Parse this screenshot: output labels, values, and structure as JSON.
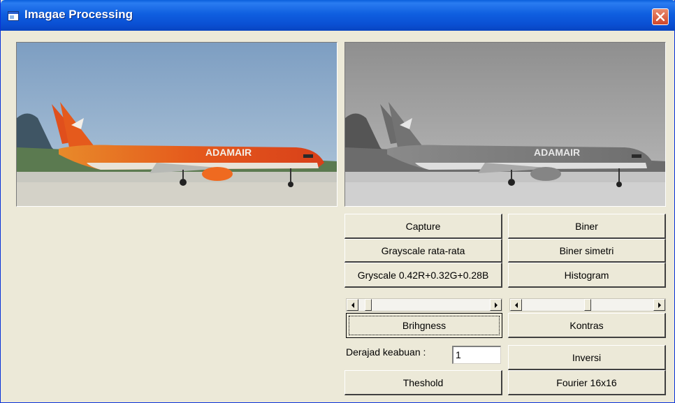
{
  "window": {
    "title": "Imagae Processing"
  },
  "images": {
    "original": {
      "airline_text": "ADAMAIR"
    },
    "processed": {
      "airline_text": "ADAMAIR"
    }
  },
  "buttons": {
    "capture": "Capture",
    "biner": "Biner",
    "grayscale_avg": "Grayscale rata-rata",
    "biner_simetri": "Biner simetri",
    "grayscale_weighted": "Gryscale 0.42R+0.32G+0.28B",
    "histogram": "Histogram",
    "brightness": "Brihgness",
    "kontras": "Kontras",
    "inversi": "Inversi",
    "threshold": "Theshold",
    "fourier": "Fourier 16x16"
  },
  "scrollbars": {
    "brightness_level": 0.05,
    "contrast_level": 0.5
  },
  "gray_level": {
    "label": "Derajad keabuan :",
    "value": "1"
  },
  "colors": {
    "titlebar": "#0a55d8",
    "face": "#ece9d8",
    "close": "#d9543a"
  }
}
